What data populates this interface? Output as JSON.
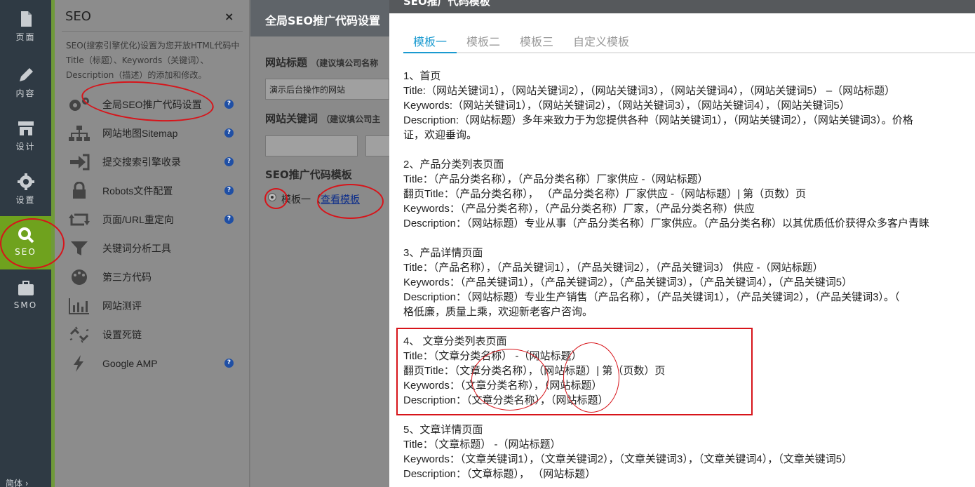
{
  "rail": {
    "items": [
      {
        "label": "页面",
        "icon": "page-icon"
      },
      {
        "label": "内容",
        "icon": "pencil-icon"
      },
      {
        "label": "设计",
        "icon": "store-icon"
      },
      {
        "label": "设置",
        "icon": "gear-icon"
      },
      {
        "label": "SEO",
        "icon": "search-icon"
      },
      {
        "label": "SMO",
        "icon": "briefcase-icon"
      }
    ],
    "language": "简体 ›"
  },
  "seo_panel": {
    "title": "SEO",
    "close": "×",
    "description": "SEO(搜索引擎优化)设置为您开放HTML代码中Title（标题）、Keywords（关键词）、Description（描述）的添加和修改。",
    "menu": [
      {
        "label": "全局SEO推广代码设置",
        "icon": "gears-icon",
        "help": true
      },
      {
        "label": "网站地图Sitemap",
        "icon": "sitemap-icon",
        "help": true
      },
      {
        "label": "提交搜索引擎收录",
        "icon": "sign-in-icon",
        "help": true
      },
      {
        "label": "Robots文件配置",
        "icon": "lock-icon",
        "help": true
      },
      {
        "label": "页面/URL重定向",
        "icon": "retweet-icon",
        "help": true
      },
      {
        "label": "关键词分析工具",
        "icon": "filter-icon",
        "help": false
      },
      {
        "label": "第三方代码",
        "icon": "palette-icon",
        "help": false
      },
      {
        "label": "网站测评",
        "icon": "bar-chart-icon",
        "help": false
      },
      {
        "label": "设置死链",
        "icon": "broken-link-icon",
        "help": false
      },
      {
        "label": "Google AMP",
        "icon": "bolt-icon",
        "help": true
      }
    ],
    "help_glyph": "?"
  },
  "middle": {
    "header": "全局SEO推广代码设置",
    "site_title_label": "网站标题",
    "site_title_hint": "（建议填公司名称",
    "site_title_value": "演示后台操作的网站",
    "site_keywords_label": "网站关键词",
    "site_keywords_hint": "（建议填公司主",
    "template_label": "SEO推广代码模板",
    "template_option": "模板一（",
    "view_template_link": "查看模板"
  },
  "modal": {
    "title": "SEO推广代码模板",
    "tabs": [
      "模板一",
      "模板二",
      "模板三",
      "自定义模板"
    ],
    "sections": [
      {
        "heading": "1、首页",
        "lines": [
          "Title:（网站关键词1），（网站关键词2），（网站关键词3），（网站关键词4），（网站关键词5） –（网站标题）",
          "Keywords:（网站关键词1），（网站关键词2），（网站关键词3），（网站关键词4），（网站关键词5）",
          "Description:（网站标题）多年来致力于为您提供各种（网站关键词1），（网站关键词2），（网站关键词3）。价格",
          "证，欢迎垂询。"
        ]
      },
      {
        "heading": "2、产品分类列表页面",
        "lines": [
          "Title：（产品分类名称），（产品分类名称）厂家供应 -（网站标题）",
          "翻页Title：（产品分类名称）， （产品分类名称）厂家供应 -（网站标题）| 第（页数）页",
          "Keywords：（产品分类名称），（产品分类名称）厂家，（产品分类名称）供应",
          "Description：（网站标题）专业从事（产品分类名称）厂家供应。（产品分类名称）以其优质低价获得众多客户青睐"
        ]
      },
      {
        "heading": "3、产品详情页面",
        "lines": [
          "Title：（产品名称），（产品关键词1），（产品关键词2），（产品关键词3） 供应 -（网站标题）",
          "Keywords：（产品关键词1），（产品关键词2），（产品关键词3），（产品关键词4），（产品关键词5）",
          "Description：（网站标题）专业生产销售（产品名称），（产品关键词1），（产品关键词2），（产品关键词3）。（",
          "格低廉，质量上乘，欢迎新老客户咨询。"
        ]
      },
      {
        "heading": "4、 文章分类列表页面",
        "lines": [
          "Title：（文章分类名称） -（网站标题）",
          "翻页Title：（文章分类名称），（网站标题）| 第（页数）页",
          "Keywords：（文章分类名称），（网站标题）",
          "Description：（文章分类名称），（网站标题）"
        ]
      },
      {
        "heading": "5、文章详情页面",
        "lines": [
          "Title：（文章标题） -（网站标题）",
          "Keywords：（文章关键词1），（文章关键词2），（文章关键词3），（文章关键词4），（文章关键词5）",
          "Description：（文章标题）， （网站标题）"
        ]
      }
    ]
  },
  "colors": {
    "accent": "#1a9ad0",
    "rail_active": "#6fa21e",
    "annotation": "#d7141a"
  }
}
